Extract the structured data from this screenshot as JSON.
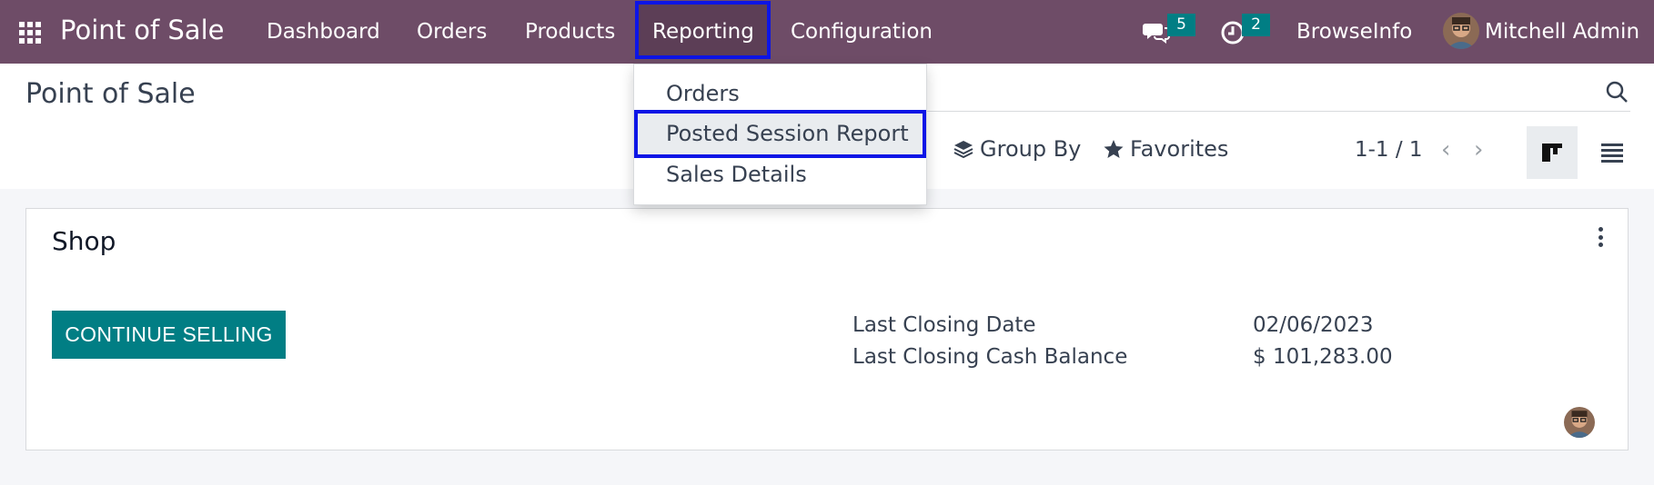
{
  "navbar": {
    "brand": "Point of Sale",
    "menu": [
      "Dashboard",
      "Orders",
      "Products",
      "Reporting",
      "Configuration"
    ],
    "messages_badge": "5",
    "activities_badge": "2",
    "company": "BrowseInfo",
    "user": "Mitchell Admin"
  },
  "control_panel": {
    "title": "Point of Sale",
    "group_by_label": "Group By",
    "favorites_label": "Favorites",
    "pager_text": "1-1 / 1"
  },
  "reporting_dropdown": {
    "items": [
      "Orders",
      "Posted Session Report",
      "Sales Details"
    ]
  },
  "card": {
    "title": "Shop",
    "continue_label": "CONTINUE SELLING",
    "last_closing_date_label": "Last Closing Date",
    "last_closing_date_value": "02/06/2023",
    "last_closing_cash_label": "Last Closing Cash Balance",
    "last_closing_cash_value": "$ 101,283.00"
  },
  "colors": {
    "navbar": "#6e4c67",
    "accent": "#017e84",
    "highlight_border": "#0d15e6"
  }
}
